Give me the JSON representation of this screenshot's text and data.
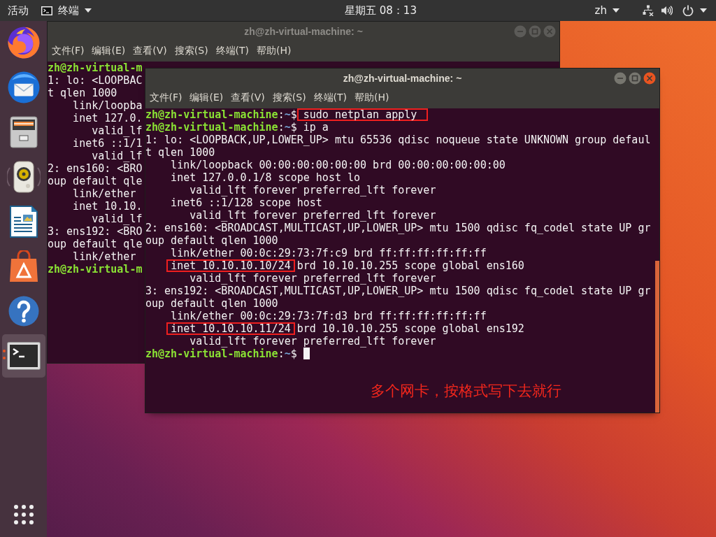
{
  "top_bar": {
    "activities": "活动",
    "app_menu": "终端",
    "clock": "星期五 08：13",
    "user_menu": "zh"
  },
  "dock": {
    "items": [
      {
        "kind": "browser",
        "focused": false,
        "running": false
      },
      {
        "kind": "mail",
        "focused": false,
        "running": false
      },
      {
        "kind": "files",
        "focused": false,
        "running": false
      },
      {
        "kind": "music",
        "focused": false,
        "running": false
      },
      {
        "kind": "writer",
        "focused": false,
        "running": false
      },
      {
        "kind": "store",
        "focused": false,
        "running": false
      },
      {
        "kind": "help",
        "focused": false,
        "running": false
      },
      {
        "kind": "terminal",
        "focused": true,
        "running": true
      }
    ]
  },
  "windows": [
    {
      "title": "zh@zh-virtual-machine: ~",
      "focused": false,
      "menu": [
        "文件(F)",
        "编辑(E)",
        "查看(V)",
        "搜索(S)",
        "终端(T)",
        "帮助(H)"
      ],
      "terminal": {
        "cursor": false,
        "lines": [
          {
            "kind": "prompt",
            "prompt": {
              "user_host": "zh@zh-virtual-m"
            }
          },
          {
            "kind": "output",
            "spans": [
              {
                "text": "1: lo: <LOOPBAC",
                "boxed": false
              }
            ]
          },
          {
            "kind": "output",
            "spans": [
              {
                "text": "t qlen 1000",
                "boxed": false
              }
            ]
          },
          {
            "kind": "output",
            "spans": [
              {
                "text": "    link/loopba",
                "boxed": false
              }
            ]
          },
          {
            "kind": "output",
            "spans": [
              {
                "text": "    inet 127.0.",
                "boxed": false
              }
            ]
          },
          {
            "kind": "output",
            "spans": [
              {
                "text": "       valid_lf",
                "boxed": false
              }
            ]
          },
          {
            "kind": "output",
            "spans": [
              {
                "text": "    inet6 ::1/1",
                "boxed": false
              }
            ]
          },
          {
            "kind": "output",
            "spans": [
              {
                "text": "       valid_lf",
                "boxed": false
              }
            ]
          },
          {
            "kind": "output",
            "spans": [
              {
                "text": "2: ens160: <BRO",
                "boxed": false
              }
            ]
          },
          {
            "kind": "output",
            "spans": [
              {
                "text": "oup default qle",
                "boxed": false
              }
            ]
          },
          {
            "kind": "output",
            "spans": [
              {
                "text": "    link/ether",
                "boxed": false
              }
            ]
          },
          {
            "kind": "output",
            "spans": [
              {
                "text": "    inet 10.10.",
                "boxed": false
              }
            ]
          },
          {
            "kind": "output",
            "spans": [
              {
                "text": "       valid_lf",
                "boxed": false
              }
            ]
          },
          {
            "kind": "output",
            "spans": [
              {
                "text": "3: ens192: <BRO",
                "boxed": false
              }
            ]
          },
          {
            "kind": "output",
            "spans": [
              {
                "text": "oup default qle",
                "boxed": false
              }
            ]
          },
          {
            "kind": "output",
            "spans": [
              {
                "text": "    link/ether",
                "boxed": false
              }
            ]
          },
          {
            "kind": "prompt",
            "prompt": {
              "user_host": "zh@zh-virtual-m"
            }
          }
        ]
      }
    },
    {
      "title": "zh@zh-virtual-machine: ~",
      "focused": true,
      "menu": [
        "文件(F)",
        "编辑(E)",
        "查看(V)",
        "搜索(S)",
        "终端(T)",
        "帮助(H)"
      ],
      "annotation": "多个网卡，按格式写下去就行",
      "terminal": {
        "cursor": true,
        "lines": [
          {
            "kind": "prompt",
            "prompt": {
              "user_host": "zh@zh-virtual-machine",
              "separator": ":",
              "path": "~",
              "symbol": "$"
            },
            "command": {
              "text": "sudo netplan apply",
              "boxed": true
            }
          },
          {
            "kind": "prompt",
            "prompt": {
              "user_host": "zh@zh-virtual-machine",
              "separator": ":",
              "path": "~",
              "symbol": "$"
            },
            "command": {
              "text": "ip a",
              "boxed": false
            }
          },
          {
            "kind": "output",
            "spans": [
              {
                "text": "1: lo: <LOOPBACK,UP,LOWER_UP> mtu 65536 qdisc noqueue state UNKNOWN group defaul",
                "boxed": false
              }
            ]
          },
          {
            "kind": "output",
            "spans": [
              {
                "text": "t qlen 1000",
                "boxed": false
              }
            ]
          },
          {
            "kind": "output",
            "spans": [
              {
                "text": "    link/loopback 00:00:00:00:00:00 brd 00:00:00:00:00:00",
                "boxed": false
              }
            ]
          },
          {
            "kind": "output",
            "spans": [
              {
                "text": "    inet 127.0.0.1/8 scope host lo",
                "boxed": false
              }
            ]
          },
          {
            "kind": "output",
            "spans": [
              {
                "text": "       valid_lft forever preferred_lft forever",
                "boxed": false
              }
            ]
          },
          {
            "kind": "output",
            "spans": [
              {
                "text": "    inet6 ::1/128 scope host",
                "boxed": false
              }
            ]
          },
          {
            "kind": "output",
            "spans": [
              {
                "text": "       valid_lft forever preferred_lft forever",
                "boxed": false
              }
            ]
          },
          {
            "kind": "output",
            "spans": [
              {
                "text": "2: ens160: <BROADCAST,MULTICAST,UP,LOWER_UP> mtu 1500 qdisc fq_codel state UP gr",
                "boxed": false
              }
            ]
          },
          {
            "kind": "output",
            "spans": [
              {
                "text": "oup default qlen 1000",
                "boxed": false
              }
            ]
          },
          {
            "kind": "output",
            "spans": [
              {
                "text": "    link/ether 00:0c:29:73:7f:c9 brd ff:ff:ff:ff:ff:ff",
                "boxed": false
              }
            ]
          },
          {
            "kind": "output",
            "spans": [
              {
                "text": "    inet 10.10.10.10/24",
                "boxed": true
              },
              {
                "text": " brd 10.10.10.255 scope global ens160",
                "boxed": false
              }
            ]
          },
          {
            "kind": "output",
            "spans": [
              {
                "text": "       valid_lft forever preferred_lft forever",
                "boxed": false
              }
            ]
          },
          {
            "kind": "output",
            "spans": [
              {
                "text": "3: ens192: <BROADCAST,MULTICAST,UP,LOWER_UP> mtu 1500 qdisc fq_codel state UP gr",
                "boxed": false
              }
            ]
          },
          {
            "kind": "output",
            "spans": [
              {
                "text": "oup default qlen 1000",
                "boxed": false
              }
            ]
          },
          {
            "kind": "output",
            "spans": [
              {
                "text": "    link/ether 00:0c:29:73:7f:d3 brd ff:ff:ff:ff:ff:ff",
                "boxed": false
              }
            ]
          },
          {
            "kind": "output",
            "spans": [
              {
                "text": "    inet 10.10.10.11/24",
                "boxed": true
              },
              {
                "text": " brd 10.10.10.255 scope global ens192",
                "boxed": false
              }
            ]
          },
          {
            "kind": "output",
            "spans": [
              {
                "text": "       valid_lft forever preferred_lft forever",
                "boxed": false
              }
            ]
          },
          {
            "kind": "prompt",
            "prompt": {
              "user_host": "zh@zh-virtual-machine",
              "separator": ":",
              "path": "~",
              "symbol": "$"
            }
          }
        ]
      }
    }
  ]
}
